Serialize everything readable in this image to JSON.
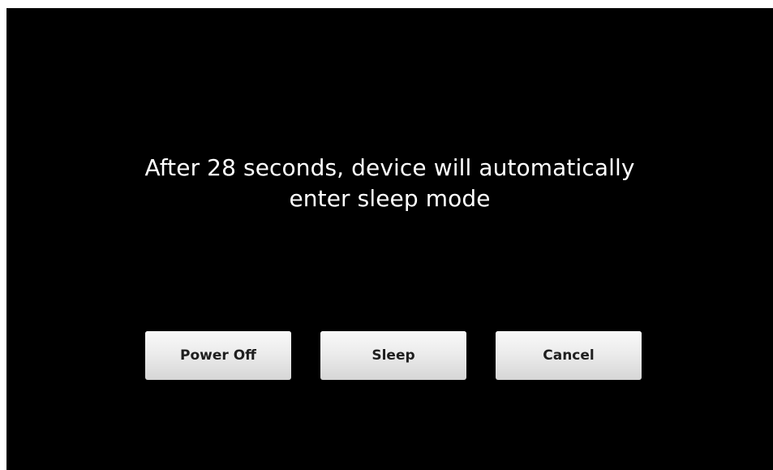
{
  "dialog": {
    "message_line1": "After 28 seconds, device will automatically",
    "message_line2": "enter sleep mode",
    "countdown_seconds": 28
  },
  "buttons": {
    "power_off_label": "Power Off",
    "sleep_label": "Sleep",
    "cancel_label": "Cancel"
  },
  "colors": {
    "background": "#000000",
    "text": "#ffffff",
    "button_face": "#ececec",
    "button_text": "#1f1f1f"
  }
}
